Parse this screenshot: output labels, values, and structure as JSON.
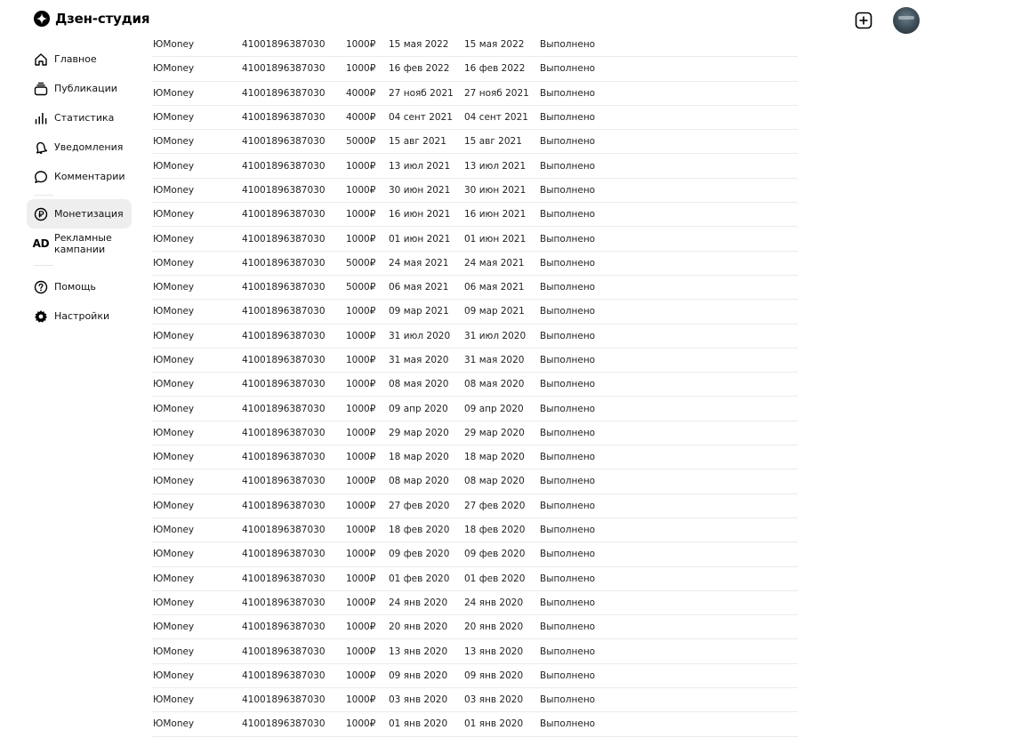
{
  "app": {
    "title": "Дзен-студия"
  },
  "sidebar": {
    "items": [
      {
        "label": "Главное"
      },
      {
        "label": "Публикации"
      },
      {
        "label": "Статистика"
      },
      {
        "label": "Уведомления"
      },
      {
        "label": "Комментарии"
      },
      {
        "label": "Монетизация",
        "active": true
      },
      {
        "label": "Рекламные кампании",
        "icon_text": "AD"
      },
      {
        "label": "Помощь"
      },
      {
        "label": "Настройки"
      }
    ]
  },
  "payouts": {
    "rows": [
      {
        "system": "ЮMoney",
        "account": "41001896387030",
        "amount": "1000₽",
        "date_requested": "15 мая 2022",
        "date_paid": "15 мая 2022",
        "status": "Выполнено"
      },
      {
        "system": "ЮMoney",
        "account": "41001896387030",
        "amount": "1000₽",
        "date_requested": "16 фев 2022",
        "date_paid": "16 фев 2022",
        "status": "Выполнено"
      },
      {
        "system": "ЮMoney",
        "account": "41001896387030",
        "amount": "4000₽",
        "date_requested": "27 нояб 2021",
        "date_paid": "27 нояб 2021",
        "status": "Выполнено"
      },
      {
        "system": "ЮMoney",
        "account": "41001896387030",
        "amount": "4000₽",
        "date_requested": "04 сент 2021",
        "date_paid": "04 сент 2021",
        "status": "Выполнено"
      },
      {
        "system": "ЮMoney",
        "account": "41001896387030",
        "amount": "5000₽",
        "date_requested": "15 авг 2021",
        "date_paid": "15 авг 2021",
        "status": "Выполнено"
      },
      {
        "system": "ЮMoney",
        "account": "41001896387030",
        "amount": "1000₽",
        "date_requested": "13 июл 2021",
        "date_paid": "13 июл 2021",
        "status": "Выполнено"
      },
      {
        "system": "ЮMoney",
        "account": "41001896387030",
        "amount": "1000₽",
        "date_requested": "30 июн 2021",
        "date_paid": "30 июн 2021",
        "status": "Выполнено"
      },
      {
        "system": "ЮMoney",
        "account": "41001896387030",
        "amount": "1000₽",
        "date_requested": "16 июн 2021",
        "date_paid": "16 июн 2021",
        "status": "Выполнено"
      },
      {
        "system": "ЮMoney",
        "account": "41001896387030",
        "amount": "1000₽",
        "date_requested": "01 июн 2021",
        "date_paid": "01 июн 2021",
        "status": "Выполнено"
      },
      {
        "system": "ЮMoney",
        "account": "41001896387030",
        "amount": "5000₽",
        "date_requested": "24 мая 2021",
        "date_paid": "24 мая 2021",
        "status": "Выполнено"
      },
      {
        "system": "ЮMoney",
        "account": "41001896387030",
        "amount": "5000₽",
        "date_requested": "06 мая 2021",
        "date_paid": "06 мая 2021",
        "status": "Выполнено"
      },
      {
        "system": "ЮMoney",
        "account": "41001896387030",
        "amount": "1000₽",
        "date_requested": "09 мар 2021",
        "date_paid": "09 мар 2021",
        "status": "Выполнено"
      },
      {
        "system": "ЮMoney",
        "account": "41001896387030",
        "amount": "1000₽",
        "date_requested": "31 июл 2020",
        "date_paid": "31 июл 2020",
        "status": "Выполнено"
      },
      {
        "system": "ЮMoney",
        "account": "41001896387030",
        "amount": "1000₽",
        "date_requested": "31 мая 2020",
        "date_paid": "31 мая 2020",
        "status": "Выполнено"
      },
      {
        "system": "ЮMoney",
        "account": "41001896387030",
        "amount": "1000₽",
        "date_requested": "08 мая 2020",
        "date_paid": "08 мая 2020",
        "status": "Выполнено"
      },
      {
        "system": "ЮMoney",
        "account": "41001896387030",
        "amount": "1000₽",
        "date_requested": "09 апр 2020",
        "date_paid": "09 апр 2020",
        "status": "Выполнено"
      },
      {
        "system": "ЮMoney",
        "account": "41001896387030",
        "amount": "1000₽",
        "date_requested": "29 мар 2020",
        "date_paid": "29 мар 2020",
        "status": "Выполнено"
      },
      {
        "system": "ЮMoney",
        "account": "41001896387030",
        "amount": "1000₽",
        "date_requested": "18 мар 2020",
        "date_paid": "18 мар 2020",
        "status": "Выполнено"
      },
      {
        "system": "ЮMoney",
        "account": "41001896387030",
        "amount": "1000₽",
        "date_requested": "08 мар 2020",
        "date_paid": "08 мар 2020",
        "status": "Выполнено"
      },
      {
        "system": "ЮMoney",
        "account": "41001896387030",
        "amount": "1000₽",
        "date_requested": "27 фев 2020",
        "date_paid": "27 фев 2020",
        "status": "Выполнено"
      },
      {
        "system": "ЮMoney",
        "account": "41001896387030",
        "amount": "1000₽",
        "date_requested": "18 фев 2020",
        "date_paid": "18 фев 2020",
        "status": "Выполнено"
      },
      {
        "system": "ЮMoney",
        "account": "41001896387030",
        "amount": "1000₽",
        "date_requested": "09 фев 2020",
        "date_paid": "09 фев 2020",
        "status": "Выполнено"
      },
      {
        "system": "ЮMoney",
        "account": "41001896387030",
        "amount": "1000₽",
        "date_requested": "01 фев 2020",
        "date_paid": "01 фев 2020",
        "status": "Выполнено"
      },
      {
        "system": "ЮMoney",
        "account": "41001896387030",
        "amount": "1000₽",
        "date_requested": "24 янв 2020",
        "date_paid": "24 янв 2020",
        "status": "Выполнено"
      },
      {
        "system": "ЮMoney",
        "account": "41001896387030",
        "amount": "1000₽",
        "date_requested": "20 янв 2020",
        "date_paid": "20 янв 2020",
        "status": "Выполнено"
      },
      {
        "system": "ЮMoney",
        "account": "41001896387030",
        "amount": "1000₽",
        "date_requested": "13 янв 2020",
        "date_paid": "13 янв 2020",
        "status": "Выполнено"
      },
      {
        "system": "ЮMoney",
        "account": "41001896387030",
        "amount": "1000₽",
        "date_requested": "09 янв 2020",
        "date_paid": "09 янв 2020",
        "status": "Выполнено"
      },
      {
        "system": "ЮMoney",
        "account": "41001896387030",
        "amount": "1000₽",
        "date_requested": "03 янв 2020",
        "date_paid": "03 янв 2020",
        "status": "Выполнено"
      },
      {
        "system": "ЮMoney",
        "account": "41001896387030",
        "amount": "1000₽",
        "date_requested": "01 янв 2020",
        "date_paid": "01 янв 2020",
        "status": "Выполнено"
      }
    ]
  },
  "colors": {
    "active_nav_bg": "#eeeeef",
    "row_border": "#ebebeb"
  }
}
